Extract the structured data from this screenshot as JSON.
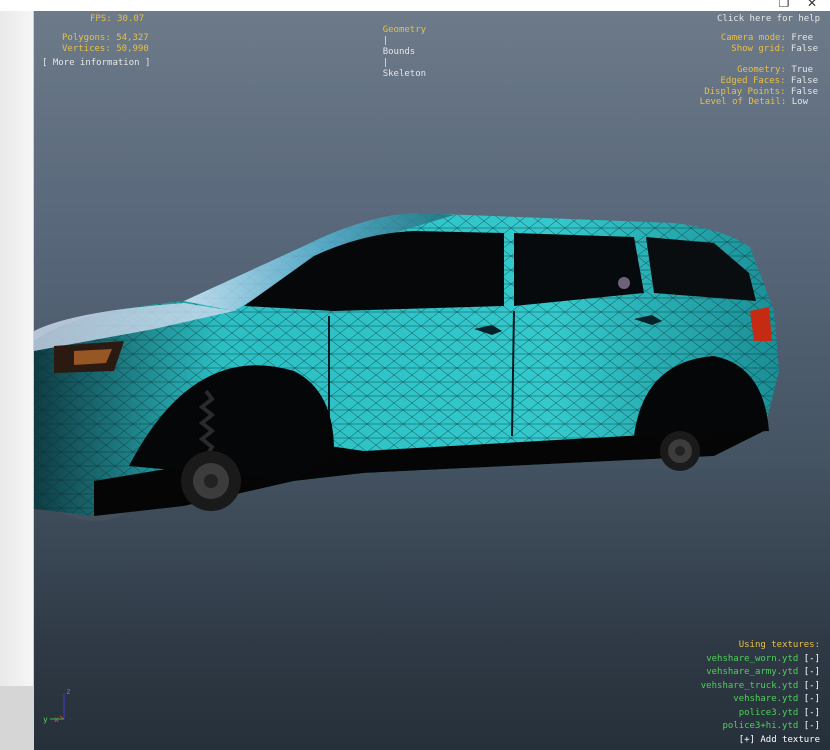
{
  "window": {
    "restore_glyph": "❐",
    "close_glyph": "✕"
  },
  "hud": {
    "fps_label": "FPS:",
    "fps_value": "30.07",
    "polygons_label": "Polygons:",
    "polygons_value": "54,327",
    "vertices_label": "Vertices:",
    "vertices_value": "50,990",
    "more_info": "[ More information ]",
    "tabs": [
      "Geometry",
      "Bounds",
      "Skeleton"
    ],
    "tab_separator": "|",
    "help": "Click here for help",
    "camera_mode_label": "Camera mode:",
    "camera_mode_value": "Free",
    "show_grid_label": "Show grid:",
    "show_grid_value": "False",
    "geometry_label": "Geometry:",
    "geometry_value": "True",
    "edged_faces_label": "Edged Faces:",
    "edged_faces_value": "False",
    "display_points_label": "Display Points:",
    "display_points_value": "False",
    "lod_label": "Level of Detail:",
    "lod_value": "Low"
  },
  "textures": {
    "heading": "Using textures:",
    "remove_label": "[-]",
    "items": [
      "vehshare_worn.ytd",
      "vehshare_army.ytd",
      "vehshare_truck.ytd",
      "vehshare.ytd",
      "police3.ytd",
      "police3+hi.ytd"
    ],
    "add_texture": "[+] Add texture"
  },
  "axis": {
    "z": "z",
    "y": "y",
    "x": "x"
  },
  "colors": {
    "hud_key": "#e8c04a",
    "hud_value": "#e6e6e6",
    "texture_green": "#4fd05a",
    "car_body": "#2bbfc4",
    "viewport_top": "#6c7a89",
    "viewport_bottom": "#26303a"
  }
}
